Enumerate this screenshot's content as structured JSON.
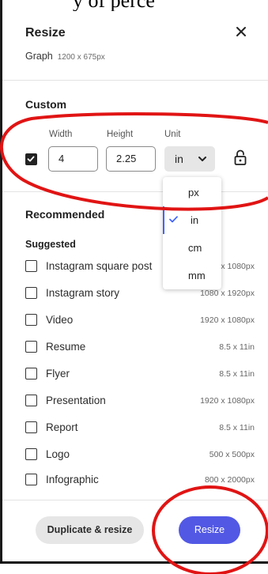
{
  "top_overflow_text": "y of perce",
  "dialog": {
    "title": "Resize",
    "doc_type": "Graph",
    "doc_dims": "1200 x 675px",
    "close_glyph": "×"
  },
  "custom": {
    "heading": "Custom",
    "width_label": "Width",
    "height_label": "Height",
    "unit_label": "Unit",
    "width_value": "4",
    "height_value": "2.25",
    "unit_value": "in",
    "lock_checked": true,
    "unit_options": [
      "px",
      "in",
      "cm",
      "mm"
    ],
    "selected_unit": "in"
  },
  "recommended": {
    "heading": "Recommended",
    "suggested_label": "Suggested",
    "items": [
      {
        "name": "Instagram square post",
        "size": "1080 x 1080px"
      },
      {
        "name": "Instagram story",
        "size": "1080 x 1920px"
      },
      {
        "name": "Video",
        "size": "1920 x 1080px"
      },
      {
        "name": "Resume",
        "size": "8.5 x 11in"
      },
      {
        "name": "Flyer",
        "size": "8.5 x 11in"
      },
      {
        "name": "Presentation",
        "size": "1920 x 1080px"
      },
      {
        "name": "Report",
        "size": "8.5 x 11in"
      },
      {
        "name": "Logo",
        "size": "500 x 500px"
      },
      {
        "name": "Infographic",
        "size": "800 x 2000px"
      }
    ]
  },
  "footer": {
    "duplicate_label": "Duplicate & resize",
    "resize_label": "Resize"
  },
  "colors": {
    "primary_button": "#5258e4",
    "annotation_red": "#e11414",
    "selection_accent": "#3f63ff"
  },
  "icons": [
    "close-icon",
    "checkmark-icon",
    "chevron-down-icon",
    "unlock-icon"
  ]
}
